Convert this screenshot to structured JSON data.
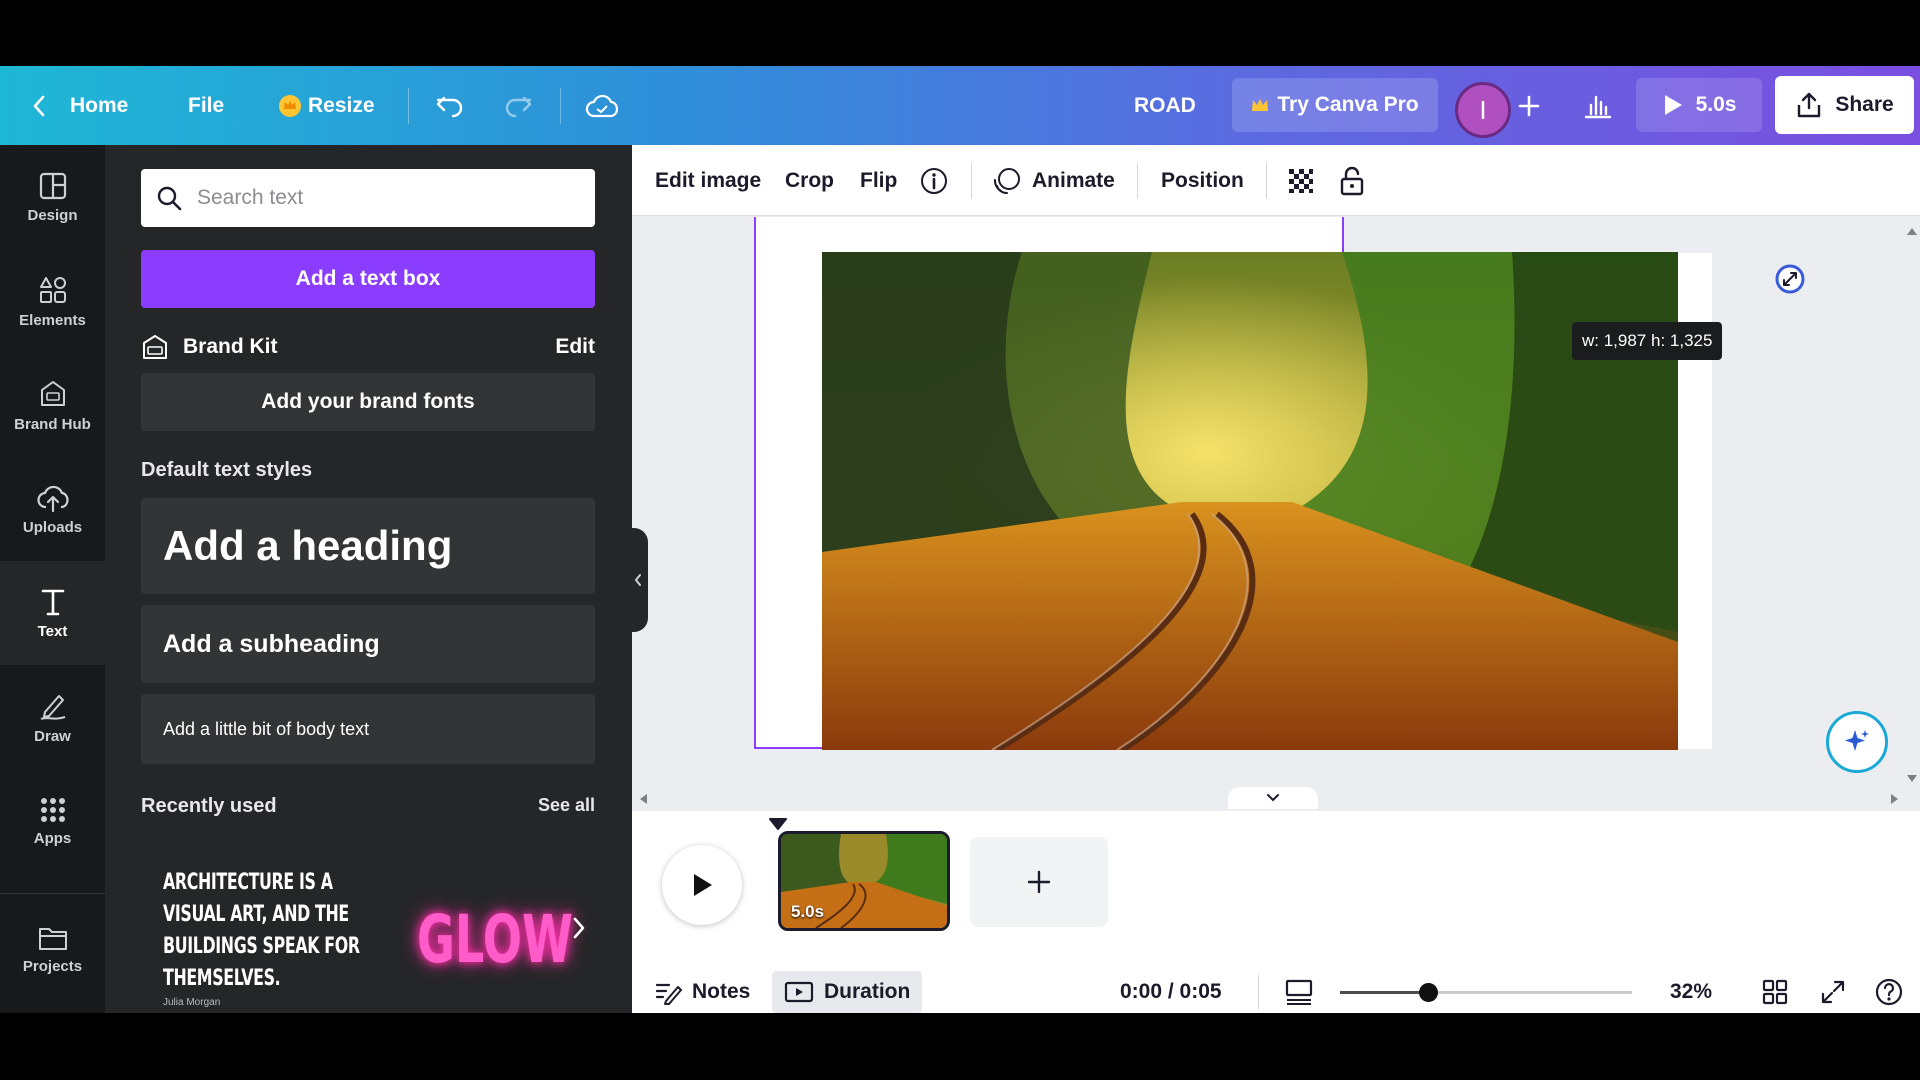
{
  "topbar": {
    "home_label": "Home",
    "file_label": "File",
    "resize_label": "Resize",
    "design_title": "ROAD",
    "try_pro_label": "Try Canva Pro",
    "avatar_initial": "I",
    "play_duration": "5.0s",
    "share_label": "Share"
  },
  "rail": {
    "items": [
      {
        "label": "Design",
        "icon": "layout-icon"
      },
      {
        "label": "Elements",
        "icon": "shapes-icon"
      },
      {
        "label": "Brand Hub",
        "icon": "brand-hub-icon"
      },
      {
        "label": "Uploads",
        "icon": "cloud-upload-icon"
      },
      {
        "label": "Text",
        "icon": "text-t-icon",
        "active": true
      },
      {
        "label": "Draw",
        "icon": "pen-icon"
      },
      {
        "label": "Apps",
        "icon": "grid-icon"
      },
      {
        "label": "Projects",
        "icon": "folder-icon"
      }
    ]
  },
  "panel": {
    "search_placeholder": "Search text",
    "add_text_box": "Add a text box",
    "brand_kit_label": "Brand Kit",
    "brand_kit_edit": "Edit",
    "add_brand_fonts": "Add your brand fonts",
    "default_styles_title": "Default text styles",
    "heading": "Add a heading",
    "subheading": "Add a subheading",
    "body": "Add a little bit of body text",
    "recently_used_title": "Recently used",
    "see_all": "See all",
    "recent_quote": [
      "Architecture is a",
      "visual art, and the",
      "buildings speak for",
      "themselves."
    ],
    "recent_quote_author": "Julia Morgan",
    "recent_glow": "GLOW"
  },
  "context_toolbar": {
    "edit_image": "Edit image",
    "crop": "Crop",
    "flip": "Flip",
    "animate": "Animate",
    "position": "Position"
  },
  "canvas": {
    "dimensions_tooltip": "w: 1,987 h: 1,325"
  },
  "timeline": {
    "page_duration": "5.0s"
  },
  "bottom": {
    "notes_label": "Notes",
    "duration_label": "Duration",
    "time_readout": "0:00 / 0:05",
    "zoom_label": "32%",
    "zoom_fraction": 0.3
  },
  "colors": {
    "accent_purple": "#8b3dff",
    "panel_bg": "#252627",
    "rail_bg": "#18191b",
    "topbar_gradient_start": "#1fb7d6",
    "topbar_gradient_end": "#7b4fe0"
  }
}
